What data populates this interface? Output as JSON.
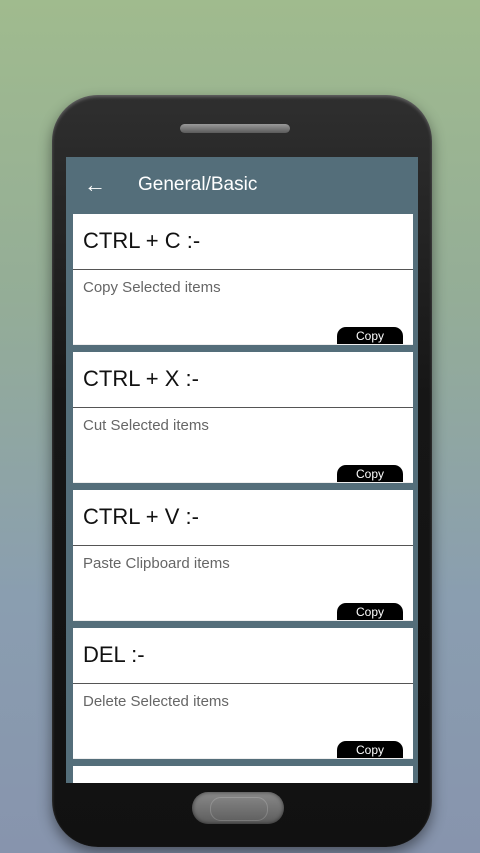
{
  "appbar": {
    "back_icon": "arrow-left-icon",
    "title": "General/Basic"
  },
  "shortcuts": [
    {
      "key": "CTRL + C :-",
      "description": "Copy Selected items",
      "button": "Copy"
    },
    {
      "key": "CTRL + X :-",
      "description": "Cut Selected items",
      "button": "Copy"
    },
    {
      "key": "CTRL + V :-",
      "description": "Paste Clipboard items",
      "button": "Copy"
    },
    {
      "key": "DEL :-",
      "description": "Delete Selected items",
      "button": "Copy"
    }
  ],
  "colors": {
    "appbar": "#546e7a",
    "card": "#ffffff",
    "button": "#000000"
  }
}
